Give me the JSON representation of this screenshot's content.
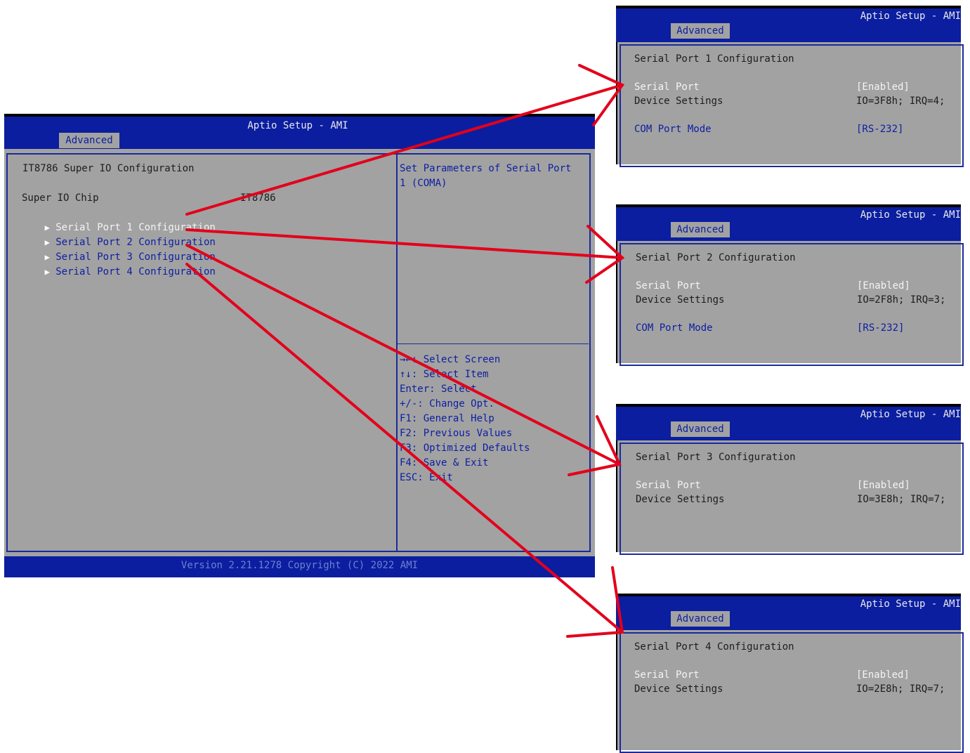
{
  "main": {
    "app_title": "Aptio Setup - AMI",
    "tab": "Advanced",
    "page_heading": "IT8786 Super IO Configuration",
    "chip_label": "Super IO Chip",
    "chip_value": "IT8786",
    "items": [
      {
        "label": "Serial Port 1 Configuration"
      },
      {
        "label": "Serial Port 2 Configuration"
      },
      {
        "label": "Serial Port 3 Configuration"
      },
      {
        "label": "Serial Port 4 Configuration"
      }
    ],
    "help_text": [
      "Set Parameters of Serial Port",
      "1 (COMA)"
    ],
    "keys": [
      "→←: Select Screen",
      "↑↓: Select Item",
      "Enter: Select",
      "+/-: Change Opt.",
      "F1: General Help",
      "F2: Previous Values",
      "F3: Optimized Defaults",
      "F4: Save & Exit",
      "ESC: Exit"
    ],
    "footer": "Version 2.21.1278 Copyright (C) 2022 AMI",
    "item_icon": "triangle-right-icon"
  },
  "subs": [
    {
      "title": "Aptio Setup - AMI",
      "tab": "Advanced",
      "heading": "Serial Port 1 Configuration",
      "serial_port_label": "Serial Port",
      "serial_port_value": "[Enabled]",
      "device_settings_label": "Device Settings",
      "device_settings_value": "IO=3F8h; IRQ=4;",
      "com_mode_label": "COM Port Mode",
      "com_mode_value": "[RS-232]"
    },
    {
      "title": "Aptio Setup - AMI",
      "tab": "Advanced",
      "heading": "Serial Port 2 Configuration",
      "serial_port_label": "Serial Port",
      "serial_port_value": "[Enabled]",
      "device_settings_label": "Device Settings",
      "device_settings_value": "IO=2F8h; IRQ=3;",
      "com_mode_label": "COM Port Mode",
      "com_mode_value": "[RS-232]"
    },
    {
      "title": "Aptio Setup - AMI",
      "tab": "Advanced",
      "heading": "Serial Port 3 Configuration",
      "serial_port_label": "Serial Port",
      "serial_port_value": "[Enabled]",
      "device_settings_label": "Device Settings",
      "device_settings_value": "IO=3E8h; IRQ=7;"
    },
    {
      "title": "Aptio Setup - AMI",
      "tab": "Advanced",
      "heading": "Serial Port 4 Configuration",
      "serial_port_label": "Serial Port",
      "serial_port_value": "[Enabled]",
      "device_settings_label": "Device Settings",
      "device_settings_value": "IO=2E8h; IRQ=7;"
    }
  ],
  "colors": {
    "bios_blue": "#0b1ea0",
    "bios_grey": "#a2a2a2",
    "annotation_red": "#e3001b"
  }
}
